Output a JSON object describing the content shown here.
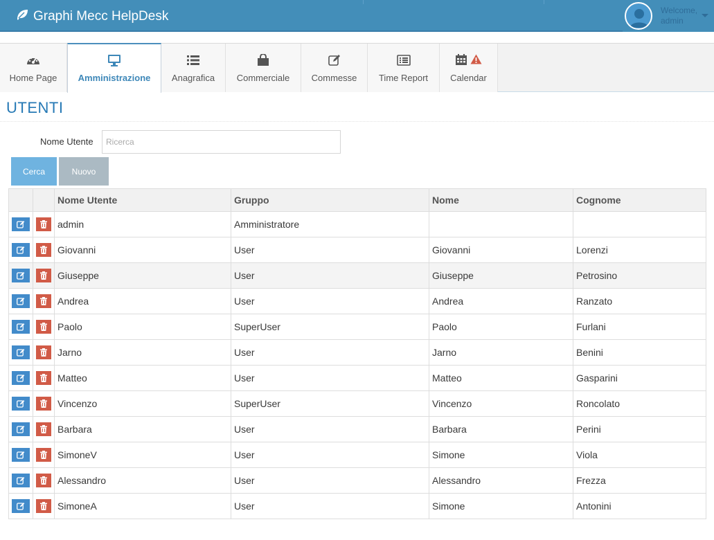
{
  "app": {
    "title": "Graphi Mecc HelpDesk",
    "logo_icon": "leaf-icon"
  },
  "user": {
    "welcome": "Welcome,",
    "name": "admin",
    "avatar_icon": "user-avatar-icon"
  },
  "tabs": [
    {
      "label": "Home Page",
      "icon": "dashboard-icon",
      "active": false
    },
    {
      "label": "Amministrazione",
      "icon": "desktop-icon",
      "active": true
    },
    {
      "label": "Anagrafica",
      "icon": "list-icon",
      "active": false
    },
    {
      "label": "Commerciale",
      "icon": "shopping-bag-icon",
      "active": false
    },
    {
      "label": "Commesse",
      "icon": "edit-icon",
      "active": false
    },
    {
      "label": "Time Report",
      "icon": "list-alt-icon",
      "active": false
    },
    {
      "label": "Calendar",
      "icon": "calendar-icon",
      "active": false,
      "badge_icon": "warning-icon"
    }
  ],
  "page": {
    "title": "UTENTI"
  },
  "search": {
    "label": "Nome Utente",
    "placeholder": "Ricerca",
    "value": ""
  },
  "buttons": {
    "search": "Cerca",
    "new": "Nuovo"
  },
  "table": {
    "columns": [
      "Nome Utente",
      "Gruppo",
      "Nome",
      "Cognome"
    ],
    "rows": [
      [
        "admin",
        "Amministratore",
        "",
        ""
      ],
      [
        "Giovanni",
        "User",
        "Giovanni",
        "Lorenzi"
      ],
      [
        "Giuseppe",
        "User",
        "Giuseppe",
        "Petrosino"
      ],
      [
        "Andrea",
        "User",
        "Andrea",
        "Ranzato"
      ],
      [
        "Paolo",
        "SuperUser",
        "Paolo",
        "Furlani"
      ],
      [
        "Jarno",
        "User",
        "Jarno",
        "Benini"
      ],
      [
        "Matteo",
        "User",
        "Matteo",
        "Gasparini"
      ],
      [
        "Vincenzo",
        "SuperUser",
        "Vincenzo",
        "Roncolato"
      ],
      [
        "Barbara",
        "User",
        "Barbara",
        "Perini"
      ],
      [
        "SimoneV",
        "User",
        "Simone",
        "Viola"
      ],
      [
        "Alessandro",
        "User",
        "Alessandro",
        "Frezza"
      ],
      [
        "SimoneA",
        "User",
        "Simone",
        "Antonini"
      ]
    ]
  },
  "colors": {
    "navbar": "#438eb9",
    "accent": "#2679b5",
    "edit_button": "#428bca",
    "delete_button": "#d15b47",
    "search_button": "#6fb3e0",
    "new_button": "#abbac3",
    "warning": "#d15b47"
  }
}
